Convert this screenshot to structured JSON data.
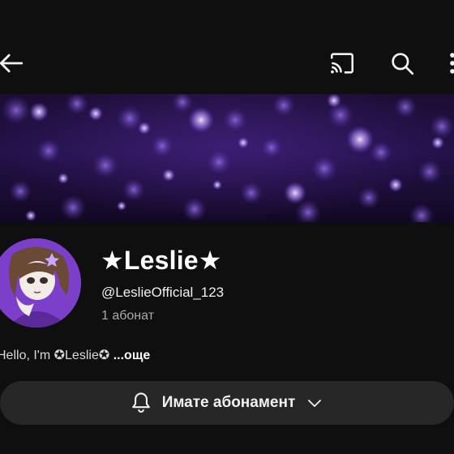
{
  "topbar": {
    "back_icon": "arrow-left-icon",
    "cast_icon": "cast-icon",
    "search_icon": "search-icon",
    "more_icon": "more-vertical-icon"
  },
  "channel": {
    "name": "★Leslie★",
    "handle": "@LeslieOfficial_123",
    "subscribers": "1 абонат",
    "description": "Hello, I'm ✪Leslie✪",
    "more_label": "...още"
  },
  "subscribe_button": {
    "label": "Имате абонамент",
    "bell_icon": "bell-icon",
    "chevron_icon": "chevron-down-icon"
  },
  "colors": {
    "background": "#0f0f0f",
    "button_bg": "#272727",
    "banner_accent": "#8a5cf5"
  }
}
